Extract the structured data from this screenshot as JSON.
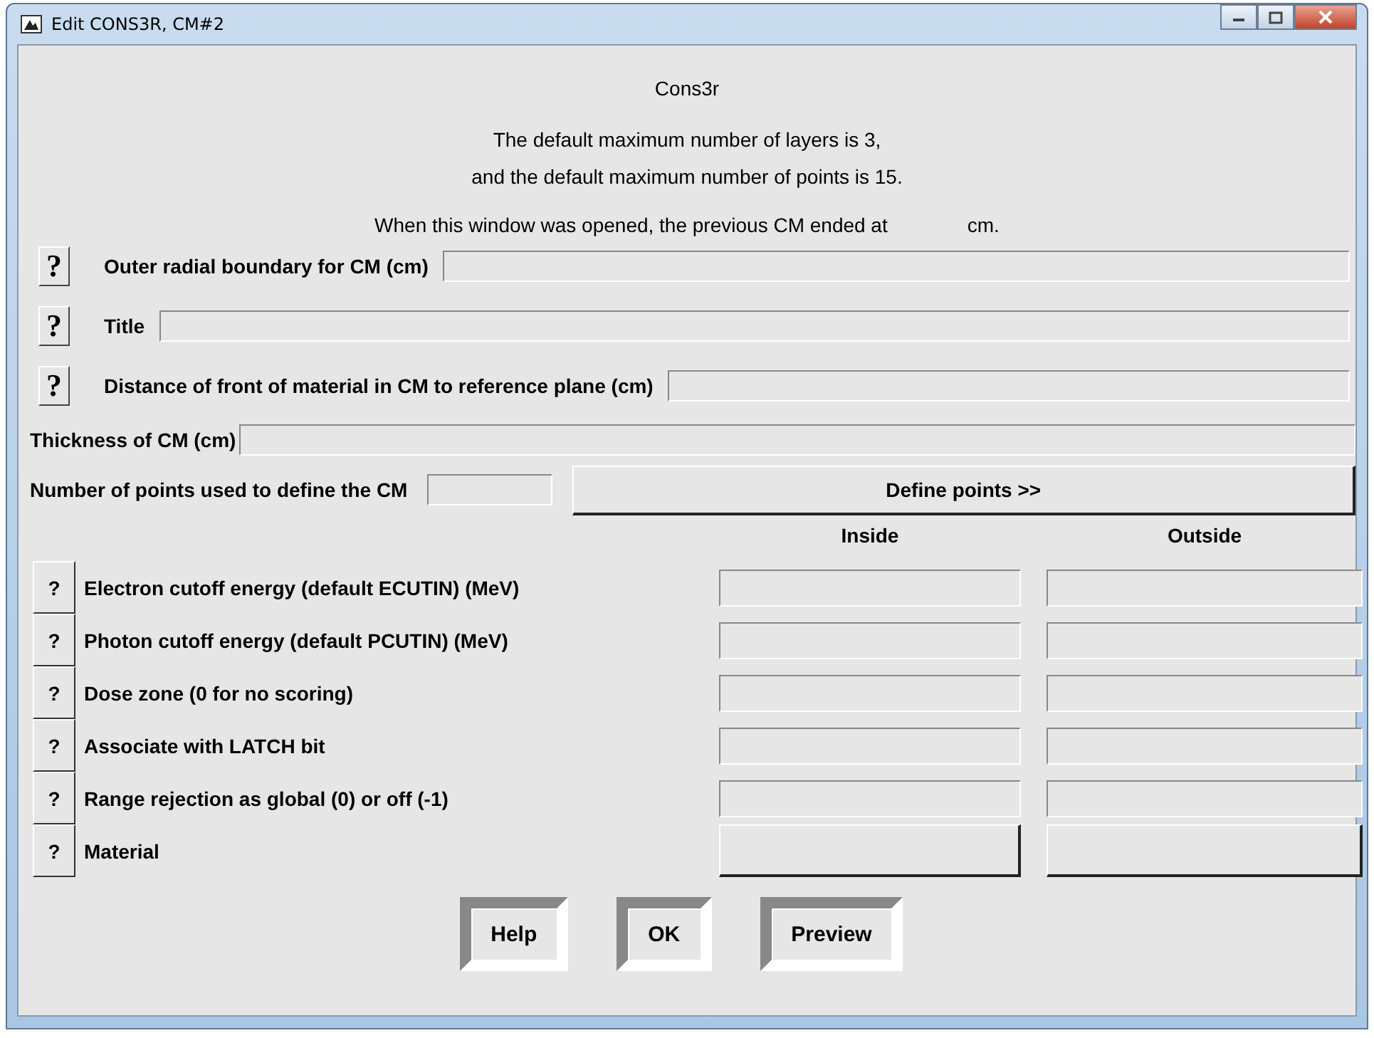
{
  "window": {
    "title": "Edit CONS3R, CM#2"
  },
  "heading": "Cons3r",
  "info_lines": [
    "The default maximum number of layers is 3,",
    "and the default maximum number of points is 15."
  ],
  "opened_note": {
    "before": "When this window was opened, the previous CM ended at",
    "after": "cm."
  },
  "top_fields": [
    {
      "kind": "help",
      "help": "?",
      "label": "Outer radial boundary for CM (cm)"
    },
    {
      "kind": "help",
      "help": "?",
      "label": "Title"
    },
    {
      "kind": "help",
      "help": "?",
      "label": "Distance of front of material in CM to reference plane (cm)"
    },
    {
      "kind": "plain",
      "label": "Thickness of CM (cm)"
    }
  ],
  "points_row": {
    "label": "Number of points used to define the CM",
    "button": "Define points >>"
  },
  "columns": [
    "Inside",
    "Outside"
  ],
  "rows": [
    {
      "kind": "field",
      "help": "?",
      "label": "Electron cutoff energy (default ECUTIN) (MeV)"
    },
    {
      "kind": "field",
      "help": "?",
      "label": "Photon cutoff energy (default PCUTIN) (MeV)"
    },
    {
      "kind": "field",
      "help": "?",
      "label": "Dose zone (0 for no scoring)"
    },
    {
      "kind": "field",
      "help": "?",
      "label": "Associate with LATCH bit"
    },
    {
      "kind": "field",
      "help": "?",
      "label": "Range rejection as global (0) or off (-1)"
    },
    {
      "kind": "menu",
      "help": "?",
      "label": "Material"
    }
  ],
  "buttons": [
    "Help",
    "OK",
    "Preview"
  ]
}
